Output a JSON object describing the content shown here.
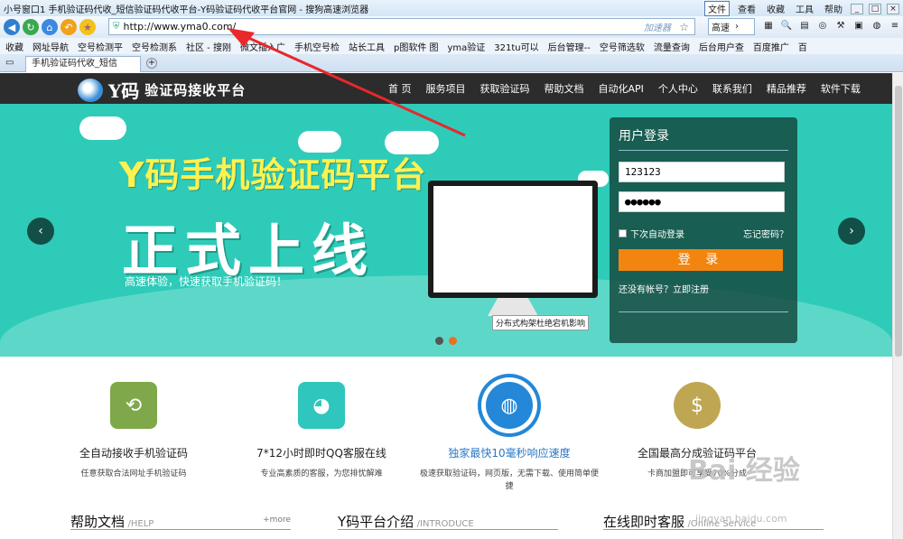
{
  "browser": {
    "title": "小号窗口1 手机验证码代收_短信验证码代收平台-Y码验证码代收平台官网 - 搜狗高速浏览器",
    "menus": [
      "文件",
      "查看",
      "收藏",
      "工具",
      "帮助"
    ],
    "url": "http://www.yma0.com/",
    "accelerator": "加速器",
    "search_engine": "高速",
    "bookmarks": [
      "收藏",
      "网址导航",
      "空号检测平",
      "空号检测系",
      "社区 - 搜刚",
      "微文插入广",
      "手机空号检",
      "站长工具",
      "p图软件 图",
      "yma验证",
      "321tu可以",
      "后台管理--",
      "空号筛选软",
      "流量查询",
      "后台用户查",
      "百度推广",
      "百"
    ],
    "tab_title": "手机验证码代收_短信"
  },
  "site": {
    "logo_y": "Y码",
    "logo_text": "验证码接收平台",
    "nav": [
      "首 页",
      "服务项目",
      "获取验证码",
      "帮助文档",
      "自动化API",
      "个人中心",
      "联系我们",
      "精品推荐",
      "软件下载"
    ]
  },
  "banner": {
    "headline": "Y码手机验证码平台",
    "headline2": "正式上线",
    "subline": "高速体验，快速获取手机验证码！",
    "prev": "‹",
    "next": "›"
  },
  "login": {
    "title": "用户登录",
    "username": "123123",
    "password": "●●●●●●",
    "remember": "下次自动登录",
    "forgot": "忘记密码？",
    "submit": "登 录",
    "register": "还没有帐号？立即注册"
  },
  "features": [
    {
      "title": "全自动接收手机验证码",
      "desc": "任意获取合法网址手机验证码",
      "color": "#7fa84a",
      "icon": "phone-refresh-icon"
    },
    {
      "title": "7*12小时即时QQ客服在线",
      "desc": "专业高素质的客服，为您排忧解难",
      "color": "#2fc6bd",
      "icon": "qq-penguin-icon"
    },
    {
      "title": "独家最快10毫秒响应速度",
      "desc": "极速获取验证码，网页版，无需下载、使用简单便捷",
      "color": "#2487d8",
      "icon": "globe-icon"
    },
    {
      "title": "全国最高分成验证码平台",
      "desc": "卡商加盟即可享受70%分成",
      "color": "#bfa653",
      "icon": "coin-stack-icon"
    }
  ],
  "tooltip": "分布式构架杜绝宕机影响",
  "sections": [
    {
      "title": "帮助文档",
      "en": "/HELP",
      "more": "+more"
    },
    {
      "title": "Y码平台介绍",
      "en": "/INTRODUCE"
    },
    {
      "title": "在线即时客服",
      "en": "/Online Service"
    }
  ],
  "watermark": {
    "brand": "Bai 经验",
    "sub": "jingyan.baidu.com"
  }
}
